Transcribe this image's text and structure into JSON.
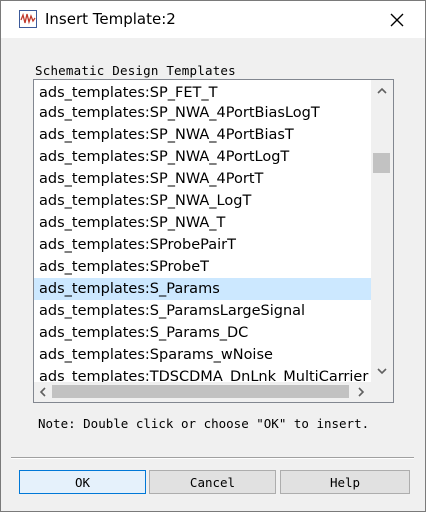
{
  "window": {
    "title": "Insert Template:2",
    "app_icon": "waveform-app-icon",
    "close_icon": "close-icon"
  },
  "group_label": "Schematic Design Templates",
  "list": {
    "items": [
      "ads_templates:SP_FET_T",
      "ads_templates:SP_NWA_4PortBiasLogT",
      "ads_templates:SP_NWA_4PortBiasT",
      "ads_templates:SP_NWA_4PortLogT",
      "ads_templates:SP_NWA_4PortT",
      "ads_templates:SP_NWA_LogT",
      "ads_templates:SP_NWA_T",
      "ads_templates:SProbePairT",
      "ads_templates:SProbeT",
      "ads_templates:S_Params",
      "ads_templates:S_ParamsLargeSignal",
      "ads_templates:S_Params_DC",
      "ads_templates:Sparams_wNoise",
      "ads_templates:TDSCDMA_DnLnk_MultiCarrier"
    ],
    "selected": "ads_templates:S_Params",
    "selected_color": "#cce8ff"
  },
  "note": "Note: Double click or choose \"OK\" to insert.",
  "buttons": {
    "ok": "OK",
    "cancel": "Cancel",
    "help": "Help"
  }
}
